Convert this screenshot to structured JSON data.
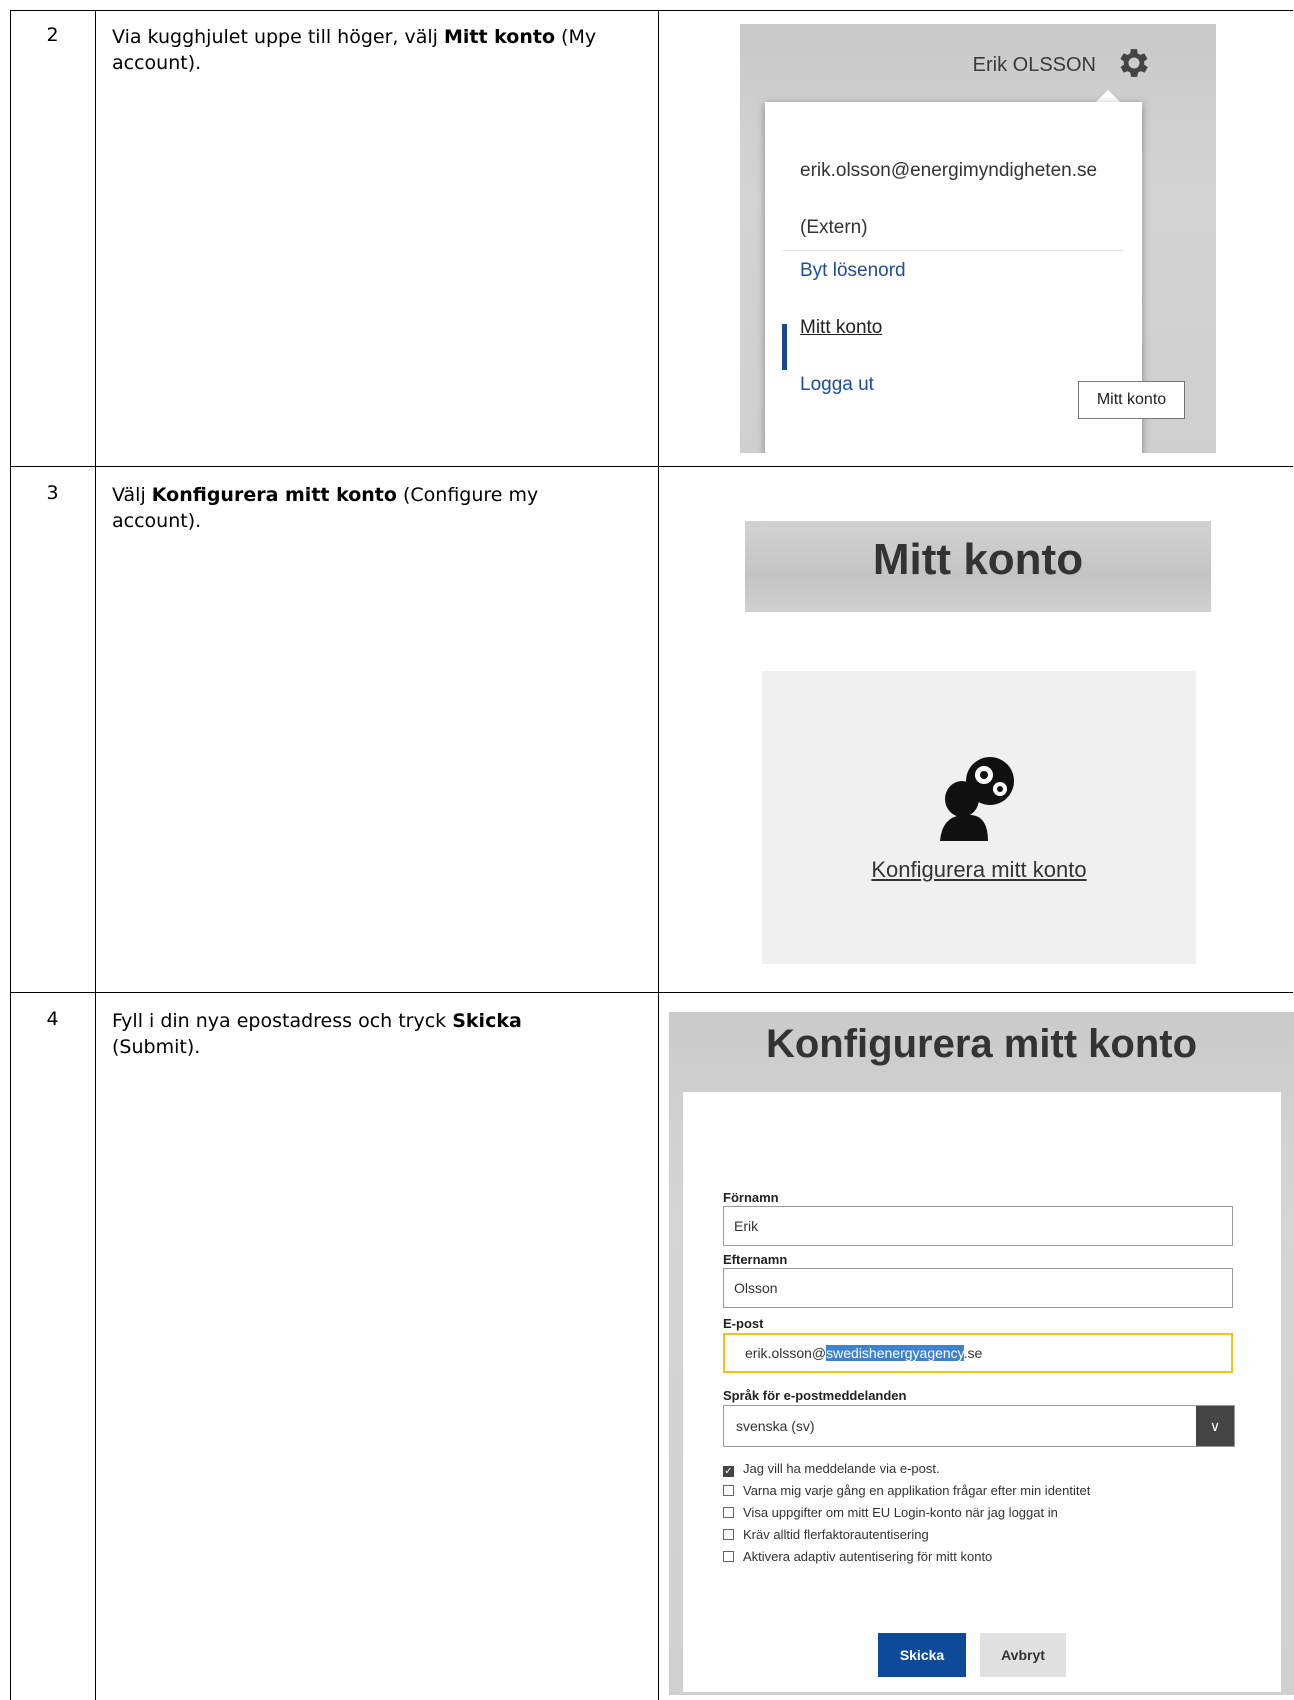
{
  "steps": [
    {
      "number": "2",
      "text_before": "Via kugghjulet uppe till höger, välj ",
      "bold": "Mitt konto",
      "text_after": " (My account)."
    },
    {
      "number": "3",
      "text_before": "Välj ",
      "bold": "Konfigurera mitt konto",
      "text_after": " (Configure my account)."
    },
    {
      "number": "4",
      "text_before": "Fyll i din nya epostadress och tryck ",
      "bold": "Skicka",
      "text_after": " (Submit)."
    }
  ],
  "menu_shot": {
    "user_name": "Erik OLSSON",
    "email": "erik.olsson@energimyndigheten.se",
    "role": "(Extern)",
    "items": [
      "Byt lösenord",
      "Mitt konto",
      "Logga ut"
    ],
    "tooltip": "Mitt konto"
  },
  "account_shot": {
    "title": "Mitt konto",
    "configure_link": "Konfigurera mitt konto"
  },
  "form_shot": {
    "title": "Konfigurera mitt konto",
    "first_name_label": "Förnamn",
    "first_name_value": "Erik",
    "last_name_label": "Efternamn",
    "last_name_value": "Olsson",
    "email_label": "E-post",
    "email_prefix": "erik.olsson@",
    "email_selected": "swedishenergyagency",
    "email_suffix": ".se",
    "language_label": "Språk för e-postmeddelanden",
    "language_value": "svenska (sv)",
    "checkboxes": [
      {
        "label": "Jag vill ha meddelande via e-post.",
        "checked": true
      },
      {
        "label": "Varna mig varje gång en applikation frågar efter min identitet",
        "checked": false
      },
      {
        "label": "Visa uppgifter om mitt EU Login-konto när jag loggat in",
        "checked": false
      },
      {
        "label": "Kräv alltid flerfaktorautentisering",
        "checked": false
      },
      {
        "label": "Aktivera adaptiv autentisering för mitt konto",
        "checked": false
      }
    ],
    "submit_label": "Skicka",
    "cancel_label": "Avbryt"
  }
}
